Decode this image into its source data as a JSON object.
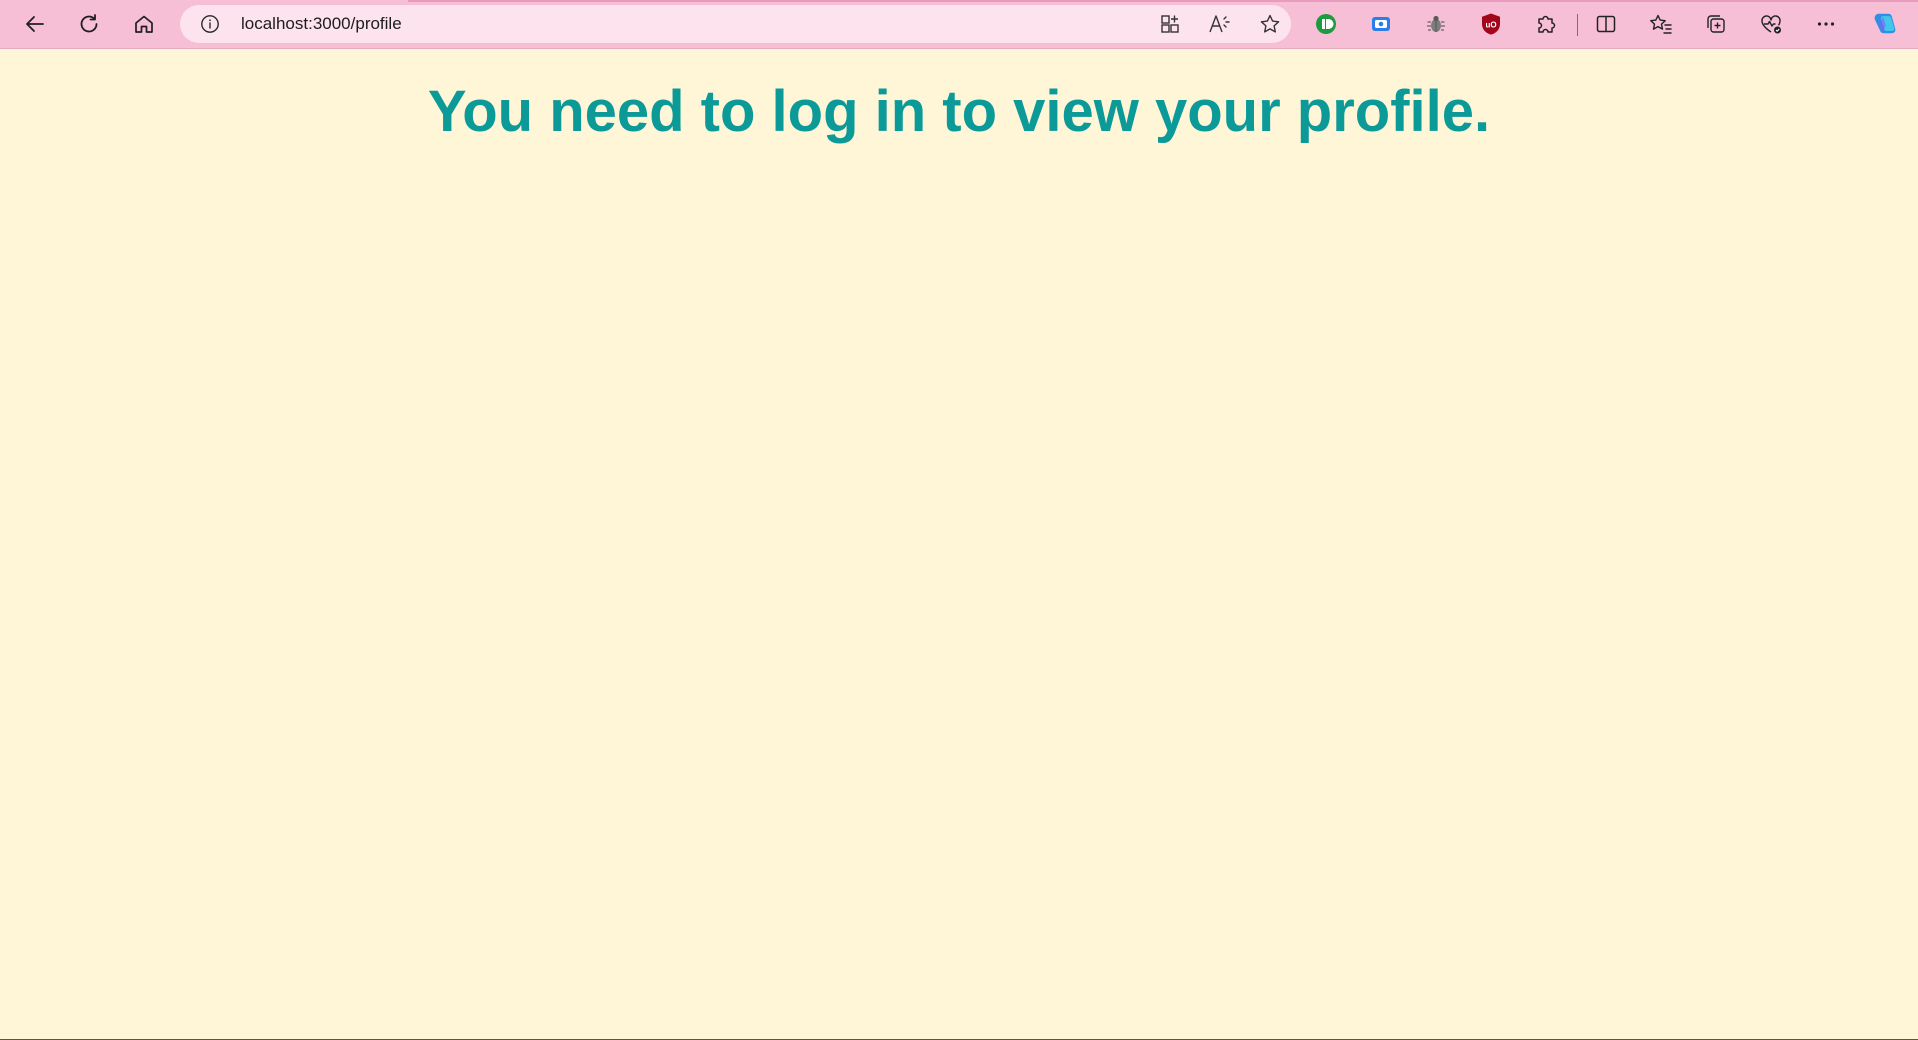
{
  "browser": {
    "url": "localhost:3000/profile",
    "colors": {
      "toolbar": "#f7bfd6",
      "address_bar": "#fde3ed",
      "page_background": "#fff6d8",
      "heading": "#0b9a98"
    },
    "nav_icons": [
      "back-arrow-icon",
      "refresh-icon",
      "home-icon"
    ],
    "address_bar_icons": [
      "info-icon",
      "app-available-icon",
      "read-aloud-icon",
      "favorite-star-icon"
    ],
    "extension_icons": [
      "green-extension-icon",
      "blue-screen-extension-icon",
      "bug-extension-icon",
      "ublock-shield-icon",
      "extensions-puzzle-icon"
    ],
    "toolbar_icons": [
      "split-screen-icon",
      "favorites-icon",
      "collections-icon",
      "browser-essentials-icon",
      "more-options-icon",
      "copilot-icon"
    ]
  },
  "page": {
    "heading": "You need to log in to view your profile."
  }
}
